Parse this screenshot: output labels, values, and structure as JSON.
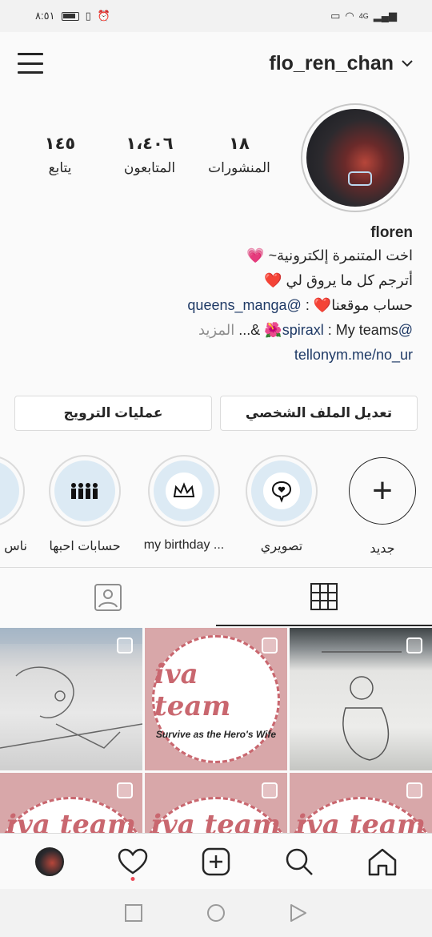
{
  "status_bar": {
    "time": "٨:٥١",
    "network": "4G"
  },
  "header": {
    "username": "flo_ren_chan"
  },
  "profile": {
    "stats": [
      {
        "value": "١٨",
        "label": "المنشورات"
      },
      {
        "value": "١،٤٠٦",
        "label": "المتابعون"
      },
      {
        "value": "١٤٥",
        "label": "يتابع"
      }
    ],
    "name": "floren",
    "bio_lines": [
      "اخت المتنمرة إلكترونية~ 💗",
      "أترجم كل ما يروق لي ❤️"
    ],
    "site_label": "حساب موقعنا❤️ : ",
    "site_handle": "@queens_manga",
    "teams_handle": "@spiraxl",
    "teams_label": " : My teams🌺 &...",
    "more_label": " المزيد",
    "link": "tellonym.me/no_ur"
  },
  "buttons": {
    "edit_profile": "تعديل الملف الشخصي",
    "promotions": "عمليات الترويج"
  },
  "highlights": [
    {
      "label": "جديد",
      "icon": "plus-icon"
    },
    {
      "label": "تصويري",
      "icon": "heart-bubble-icon"
    },
    {
      "label": "my birthday ...",
      "icon": "crown-icon"
    },
    {
      "label": "حسابات احبها",
      "icon": "people-icon"
    },
    {
      "label": "ناس",
      "icon": "circle"
    }
  ],
  "grid_text": {
    "team": "iva team",
    "caption": "Survive as the Hero's Wife"
  },
  "colors": {
    "accent_pink": "#c9676f",
    "link": "#1f3a66",
    "notify": "#ed4956"
  }
}
